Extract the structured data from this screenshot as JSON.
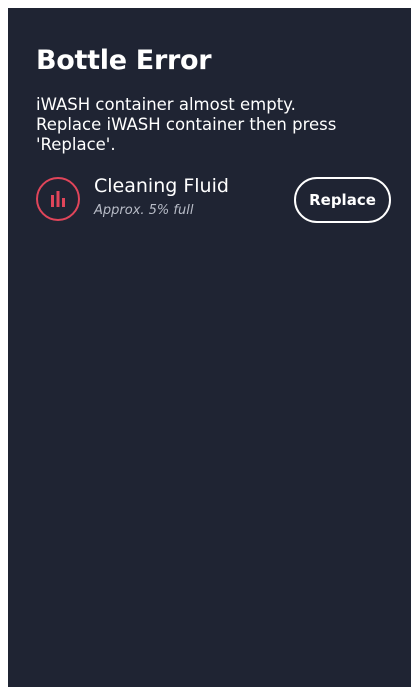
{
  "dialog": {
    "title": "Bottle Error",
    "message_lines": [
      "iWASH container almost empty.",
      "Replace iWASH container then press",
      "'Replace'."
    ]
  },
  "fluid": {
    "name": "Cleaning Fluid",
    "level_text": "Approx. 5% full",
    "level_fraction": 0.05,
    "icon": "bar-level-icon",
    "status_color": "#e0455a"
  },
  "actions": {
    "replace_label": "Replace"
  },
  "colors": {
    "panel_background": "#1f2433",
    "text_primary": "#ffffff",
    "text_secondary": "#b9bdc8",
    "alert": "#e0455a"
  }
}
